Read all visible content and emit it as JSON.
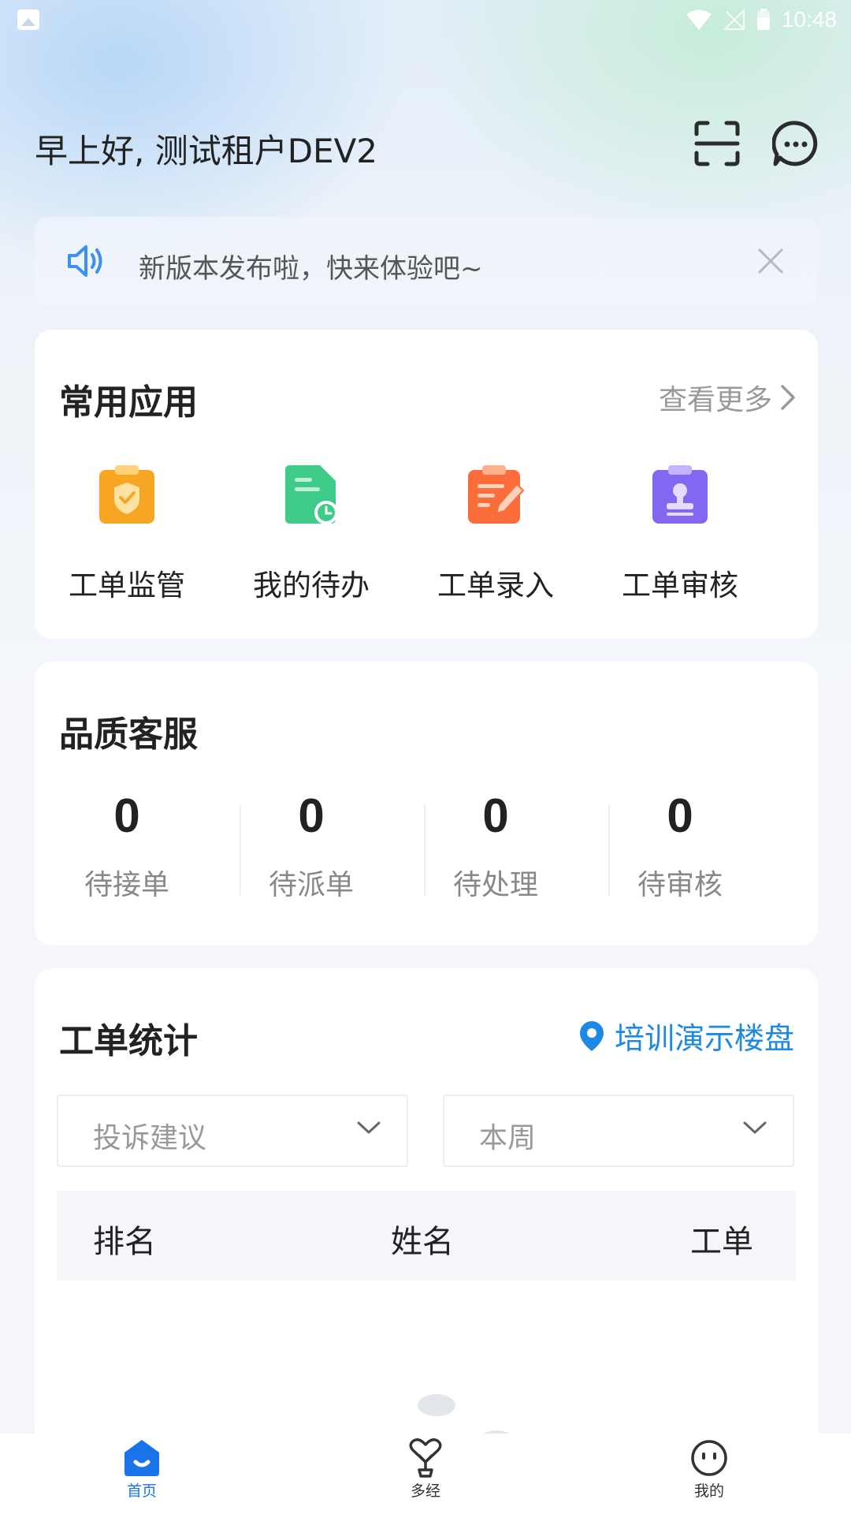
{
  "status_bar": {
    "time": "10:48"
  },
  "header": {
    "greeting": "早上好, 测试租户DEV2"
  },
  "notice": {
    "text": "新版本发布啦，快来体验吧~"
  },
  "apps_card": {
    "title": "常用应用",
    "see_more": "查看更多",
    "apps": [
      {
        "label": "工单监管",
        "icon": "shield-clipboard-icon",
        "color": "#f7a624"
      },
      {
        "label": "我的待办",
        "icon": "document-clock-icon",
        "color": "#3fcb8a"
      },
      {
        "label": "工单录入",
        "icon": "clipboard-edit-icon",
        "color": "#fb6d3a"
      },
      {
        "label": "工单审核",
        "icon": "clipboard-stamp-icon",
        "color": "#8467f0"
      }
    ]
  },
  "quality_card": {
    "title": "品质客服",
    "stats": [
      {
        "value": "0",
        "label": "待接单"
      },
      {
        "value": "0",
        "label": "待派单"
      },
      {
        "value": "0",
        "label": "待处理"
      },
      {
        "value": "0",
        "label": "待审核"
      }
    ]
  },
  "workorder_card": {
    "title": "工单统计",
    "location": "培训演示楼盘",
    "filter_type": "投诉建议",
    "filter_period": "本周",
    "columns": [
      "排名",
      "姓名",
      "工单"
    ]
  },
  "tabbar": {
    "items": [
      {
        "label": "首页",
        "active": true
      },
      {
        "label": "多经",
        "active": false
      },
      {
        "label": "我的",
        "active": false
      }
    ]
  },
  "colors": {
    "accent": "#1e88e5",
    "tab_active": "#1a73e8",
    "tab_inactive": "#333333"
  }
}
